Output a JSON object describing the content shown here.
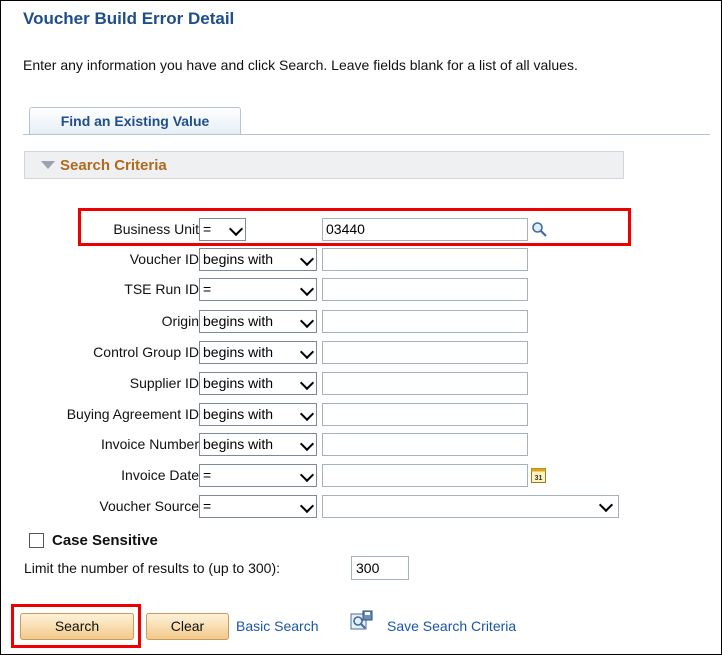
{
  "page": {
    "title": "Voucher Build Error Detail",
    "instructions": "Enter any information you have and click Search. Leave fields blank for a list of all values."
  },
  "tab": {
    "label": "Find an Existing Value"
  },
  "criteria": {
    "label": "Search Criteria"
  },
  "fields": [
    {
      "label": "Business Unit",
      "operator": "=",
      "value": "03440"
    },
    {
      "label": "Voucher ID",
      "operator": "begins with",
      "value": ""
    },
    {
      "label": "TSE Run ID",
      "operator": "=",
      "value": ""
    },
    {
      "label": "Origin",
      "operator": "begins with",
      "value": ""
    },
    {
      "label": "Control Group ID",
      "operator": "begins with",
      "value": ""
    },
    {
      "label": "Supplier ID",
      "operator": "begins with",
      "value": ""
    },
    {
      "label": "Buying Agreement ID",
      "operator": "begins with",
      "value": ""
    },
    {
      "label": "Invoice Number",
      "operator": "begins with",
      "value": ""
    },
    {
      "label": "Invoice Date",
      "operator": "=",
      "value": ""
    },
    {
      "label": "Voucher Source",
      "operator": "=",
      "value": ""
    }
  ],
  "case_sensitive": {
    "label": "Case Sensitive",
    "checked": false
  },
  "limit": {
    "label": "Limit the number of results to (up to 300):",
    "value": "300"
  },
  "buttons": {
    "search": "Search",
    "clear": "Clear"
  },
  "links": {
    "basic_search": "Basic Search",
    "save_search": "Save Search Criteria"
  },
  "calendar_icon_text": "31",
  "colors": {
    "title": "#1f4e8a",
    "criteria_label": "#b06a1d",
    "link": "#1b55a8",
    "highlight": "#e00000",
    "button": "#f1c98a"
  }
}
